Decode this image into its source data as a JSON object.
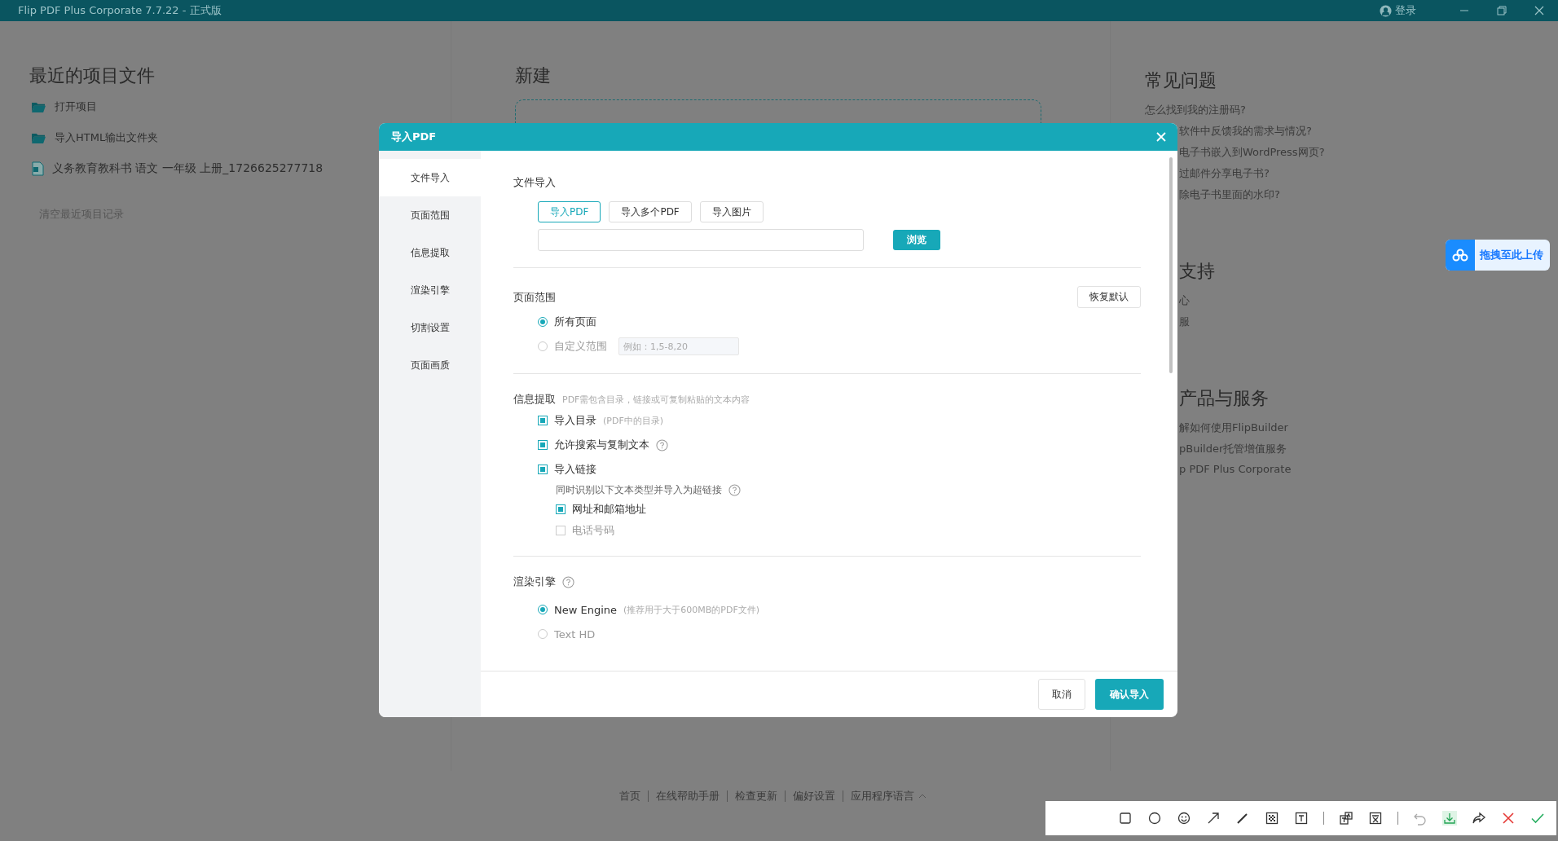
{
  "title_bar": {
    "title": "Flip PDF Plus Corporate 7.7.22 - 正式版",
    "login": "登录"
  },
  "recent": {
    "heading": "最近的项目文件",
    "actions": [
      {
        "label": "打开项目"
      },
      {
        "label": "导入HTML输出文件夹"
      }
    ],
    "files": [
      {
        "name": "义务教育教科书 语文 一年级 上册_1726625277718"
      }
    ],
    "clear": "清空最近项目记录"
  },
  "new_project": {
    "heading": "新建"
  },
  "help": {
    "sections": [
      {
        "heading": "常见问题",
        "covered": false,
        "links": [
          {
            "text": "怎么找到我的注册码?",
            "covered": false
          },
          {
            "text": "软件中反馈我的需求与情况?",
            "covered": true
          },
          {
            "text": "电子书嵌入到WordPress网页?",
            "covered": true
          },
          {
            "text": "过邮件分享电子书?",
            "covered": true
          },
          {
            "text": "除电子书里面的水印?",
            "covered": true
          }
        ]
      },
      {
        "heading": "支持",
        "covered": true,
        "links": [
          {
            "text": "心",
            "covered": true
          },
          {
            "text": "服",
            "covered": true
          }
        ]
      },
      {
        "heading": "产品与服务",
        "covered": true,
        "links": [
          {
            "text": "解如何使用FlipBuilder",
            "covered": true
          },
          {
            "text": "pBuilder托管增值服务",
            "covered": true
          },
          {
            "text": "p PDF Plus Corporate",
            "covered": true
          }
        ]
      }
    ]
  },
  "upload_widget": {
    "label": "拖拽至此上传"
  },
  "footer": {
    "links": [
      "首页",
      "在线帮助手册",
      "检查更新",
      "偏好设置",
      "应用程序语言"
    ]
  },
  "dialog": {
    "title": "导入PDF",
    "nav": [
      {
        "label": "文件导入",
        "selected": true
      },
      {
        "label": "页面范围",
        "selected": false
      },
      {
        "label": "信息提取",
        "selected": false
      },
      {
        "label": "渲染引擎",
        "selected": false
      },
      {
        "label": "切割设置",
        "selected": false
      },
      {
        "label": "页面画质",
        "selected": false
      }
    ],
    "file_import": {
      "heading": "文件导入",
      "modes": [
        {
          "label": "导入PDF",
          "selected": true
        },
        {
          "label": "导入多个PDF",
          "selected": false
        },
        {
          "label": "导入图片",
          "selected": false
        }
      ],
      "browse": "浏览"
    },
    "page_range": {
      "heading": "页面范围",
      "reset": "恢复默认",
      "options": [
        {
          "label": "所有页面",
          "selected": true
        },
        {
          "label": "自定义范围",
          "selected": false,
          "placeholder": "例如：1,5-8,20"
        }
      ]
    },
    "info": {
      "heading": "信息提取",
      "hint": "PDF需包含目录，链接或可复制粘贴的文本内容",
      "options": [
        {
          "label": "导入目录",
          "note": "(PDF中的目录)",
          "checked": true,
          "help": false
        },
        {
          "label": "允许搜索与复制文本",
          "checked": true,
          "help": true
        },
        {
          "label": "导入链接",
          "checked": true,
          "help": false,
          "sub": {
            "text": "同时识别以下文本类型并导入为超链接",
            "help": true,
            "options": [
              {
                "label": "网址和邮箱地址",
                "checked": true
              },
              {
                "label": "电话号码",
                "checked": false
              }
            ]
          }
        }
      ]
    },
    "render": {
      "heading": "渲染引擎",
      "help": true,
      "options": [
        {
          "label": "New Engine",
          "note": "(推荐用于大于600MB的PDF文件)",
          "selected": true
        },
        {
          "label": "Text HD",
          "selected": false
        }
      ]
    },
    "buttons": {
      "cancel": "取消",
      "confirm": "确认导入"
    }
  }
}
